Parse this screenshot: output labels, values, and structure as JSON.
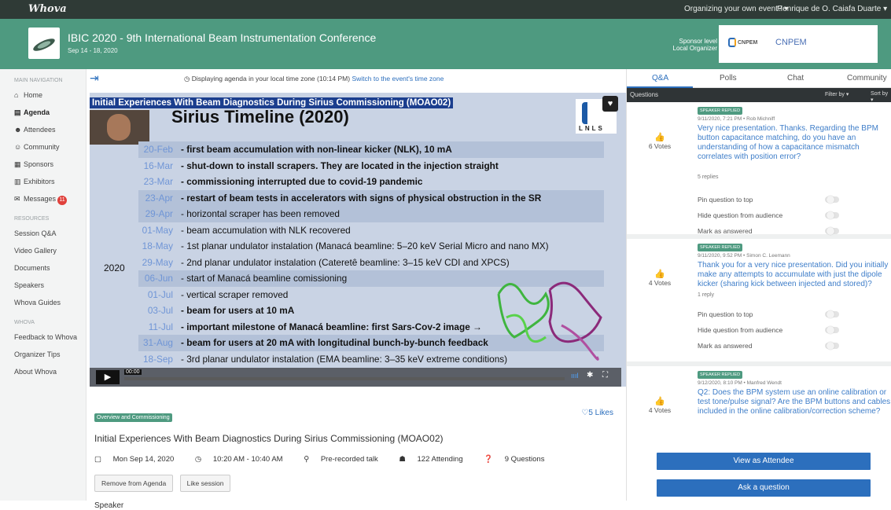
{
  "topbar": {
    "logo": "Whova",
    "organizing": "Organizing your own event? ▾",
    "user": "Henrique de O. Caiafa Duarte ▾"
  },
  "header": {
    "title": "IBIC 2020 - 9th International Beam Instrumentation Conference",
    "dates": "Sep 14 - 18, 2020",
    "sponsor_label_1": "Sponsor level",
    "sponsor_label_2": "Local Organizer",
    "sponsor_logo": "CNPEM",
    "sponsor_name": "CNPEM"
  },
  "sidebar": {
    "main_nav_label": "MAIN NAVIGATION",
    "items": [
      {
        "icon": "⌂",
        "label": "Home"
      },
      {
        "icon": "▤",
        "label": "Agenda"
      },
      {
        "icon": "☻",
        "label": "Attendees"
      },
      {
        "icon": "☺",
        "label": "Community"
      },
      {
        "icon": "▦",
        "label": "Sponsors"
      },
      {
        "icon": "▥",
        "label": "Exhibitors"
      },
      {
        "icon": "✉",
        "label": "Messages",
        "badge": "11"
      }
    ],
    "resources_label": "RESOURCES",
    "resources": [
      "Session Q&A",
      "Video Gallery",
      "Documents",
      "Speakers",
      "Whova Guides"
    ],
    "whova_label": "WHOVA",
    "whova": [
      "Feedback to Whova",
      "Organizer Tips",
      "About Whova"
    ]
  },
  "timezone": {
    "text": "Displaying agenda in your local time zone (10:14 PM)",
    "link": "Switch to the event's time zone"
  },
  "video": {
    "overlay_title": "Initial Experiences With Beam Diagnostics During Sirius Commissioning (MOAO02)",
    "slide_title": "Sirius Timeline (2020)",
    "lnls": "LNLS",
    "year": "2020",
    "rows": [
      {
        "date": "20-Feb",
        "text": "- first beam accumulation with non-linear kicker (NLK), 10 mA",
        "bold": true,
        "hl": true
      },
      {
        "date": "16-Mar",
        "text": "- shut-down to install scrapers. They are located in the injection straight",
        "bold": true,
        "hl": false
      },
      {
        "date": "23-Mar",
        "text": "- commissioning interrupted due to covid-19 pandemic",
        "bold": true,
        "hl": false
      },
      {
        "date": "23-Apr",
        "text": "- restart of beam tests in accelerators with signs of physical obstruction in the SR",
        "bold": true,
        "hl": true
      },
      {
        "date": "29-Apr",
        "text": "- horizontal scraper has been removed",
        "bold": false,
        "hl": true
      },
      {
        "date": "01-May",
        "text": "- beam accumulation with NLK recovered",
        "bold": false,
        "hl": false
      },
      {
        "date": "18-May",
        "text": "- 1st planar undulator instalation (Manacá beamline: 5–20 keV Serial Micro and nano MX)",
        "bold": false,
        "hl": false
      },
      {
        "date": "29-May",
        "text": "- 2nd planar undulator instalation (Cateretê beamline: 3–15 keV CDI and XPCS)",
        "bold": false,
        "hl": false
      },
      {
        "date": "06-Jun",
        "text": "- start of Manacá beamline comissioning",
        "bold": false,
        "hl": true
      },
      {
        "date": "01-Jul",
        "text": "- vertical scraper removed",
        "bold": false,
        "hl": false
      },
      {
        "date": "03-Jul",
        "text": "- beam for users at 10 mA",
        "bold": true,
        "hl": false
      },
      {
        "date": "11-Jul",
        "text": "- important milestone of Manacá beamline: first Sars-Cov-2 image →",
        "bold": true,
        "hl": false
      },
      {
        "date": "31-Aug",
        "text": "- beam for users at 20 mA with longitudinal bunch-by-bunch feedback",
        "bold": true,
        "hl": true
      },
      {
        "date": "18-Sep",
        "text": "- 3rd planar undulator instalation (EMA beamline: 3–35 keV extreme conditions)",
        "bold": false,
        "hl": false
      }
    ],
    "time": "00:00"
  },
  "session": {
    "tag": "Overview and Commissioning",
    "likes": "5 Likes",
    "title": "Initial Experiences With Beam Diagnostics During Sirius Commissioning (MOAO02)",
    "date": "Mon  Sep 14, 2020",
    "time": "10:20 AM - 10:40 AM",
    "type": "Pre-recorded talk",
    "attending": "122 Attending",
    "questions": "9 Questions",
    "btn_remove": "Remove from Agenda",
    "btn_like": "Like session",
    "speaker_label": "Speaker"
  },
  "panel": {
    "tabs": [
      "Q&A",
      "Polls",
      "Chat",
      "Community"
    ],
    "questions_label": "Questions",
    "filter": "Filter by ▾",
    "sort": "Sort by ▾",
    "opts": [
      "Pin question to top",
      "Hide question from audience",
      "Mark as answered"
    ],
    "replied": "SPEAKER REPLIED",
    "cards": [
      {
        "votes": "6  Votes",
        "author": "9/11/2020, 7:21 PM • Rob Michniff",
        "q": "Very nice presentation. Thanks. Regarding the BPM button capacitance matching, do you have an understanding of how a capacitance mismatch correlates with position error?",
        "replies": "5 replies"
      },
      {
        "votes": "4  Votes",
        "author": "9/11/2020, 9:52 PM • Simon C. Leemann",
        "q": "Thank you for a very nice presentation. Did you initially make any attempts to accumulate with just the dipole kicker (sharing kick between injected and stored)?",
        "replies": "1 reply"
      },
      {
        "votes": "4  Votes",
        "author": "9/12/2020, 8:10 PM • Manfred Wendt",
        "q": "Q2: Does the BPM system use an online calibration or test tone/pulse signal? Are the BPM buttons and cables included in the online calibration/correction scheme?",
        "replies": ""
      }
    ],
    "view_btn": "View as Attendee",
    "ask_btn": "Ask a question"
  }
}
